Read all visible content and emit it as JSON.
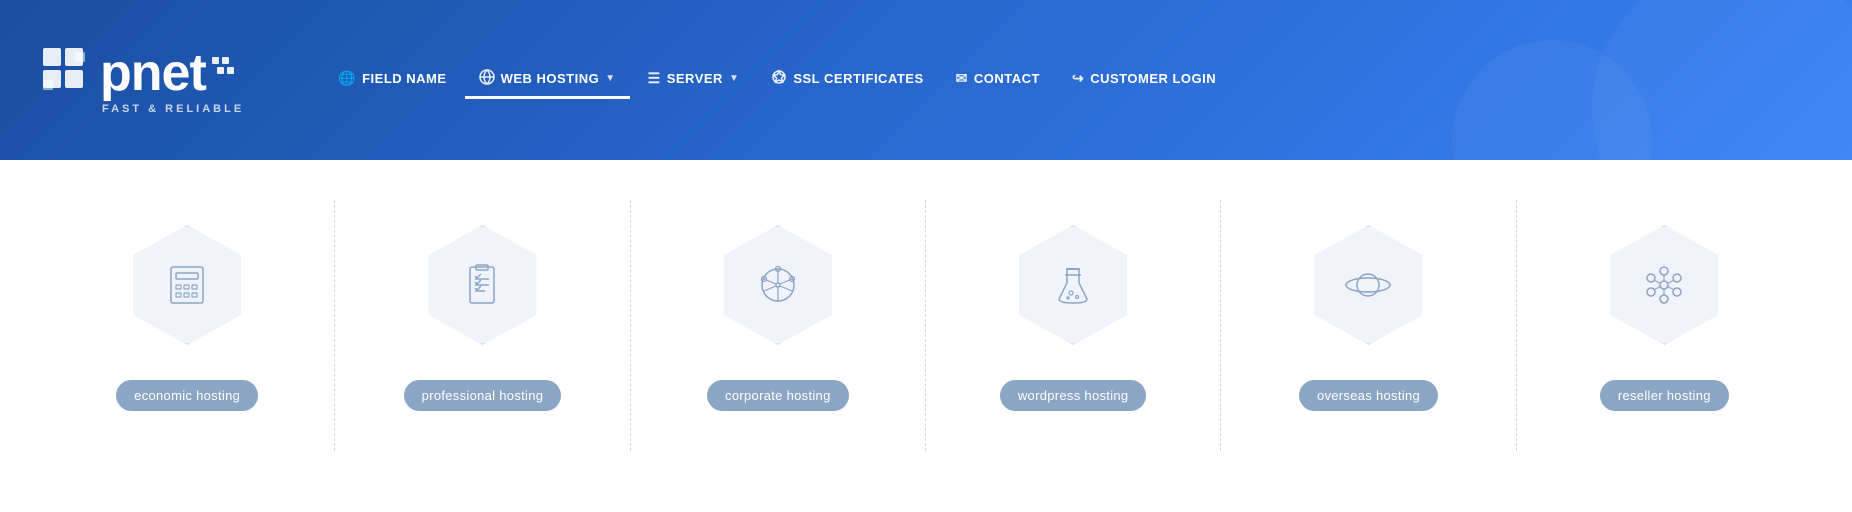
{
  "header": {
    "logo": {
      "brand": "pnet",
      "tagline": "FAST & RELIABLE"
    },
    "nav": {
      "items": [
        {
          "id": "field-name",
          "icon": "🌐",
          "label": "FIELD NAME",
          "hasArrow": false,
          "active": false
        },
        {
          "id": "web-hosting",
          "icon": "🔄",
          "label": "WEB HOSTING",
          "hasArrow": true,
          "active": true
        },
        {
          "id": "server",
          "icon": "☰",
          "label": "SERVER",
          "hasArrow": true,
          "active": false
        },
        {
          "id": "ssl-certificates",
          "icon": "✦",
          "label": "SSL CERTIFICATES",
          "hasArrow": false,
          "active": false
        },
        {
          "id": "contact",
          "icon": "✉",
          "label": "CONTACT",
          "hasArrow": false,
          "active": false
        },
        {
          "id": "customer-login",
          "icon": "↪",
          "label": "CUSTOMER LOGIN",
          "hasArrow": false,
          "active": false
        }
      ]
    }
  },
  "hosting": {
    "items": [
      {
        "id": "economic",
        "label": "economic hosting",
        "iconType": "calculator"
      },
      {
        "id": "professional",
        "label": "professional hosting",
        "iconType": "checklist"
      },
      {
        "id": "corporate",
        "label": "corporate hosting",
        "iconType": "network"
      },
      {
        "id": "wordpress",
        "label": "wordpress hosting",
        "iconType": "flask"
      },
      {
        "id": "overseas",
        "label": "overseas hosting",
        "iconType": "planet"
      },
      {
        "id": "reseller",
        "label": "reseller hosting",
        "iconType": "molecule"
      }
    ]
  }
}
